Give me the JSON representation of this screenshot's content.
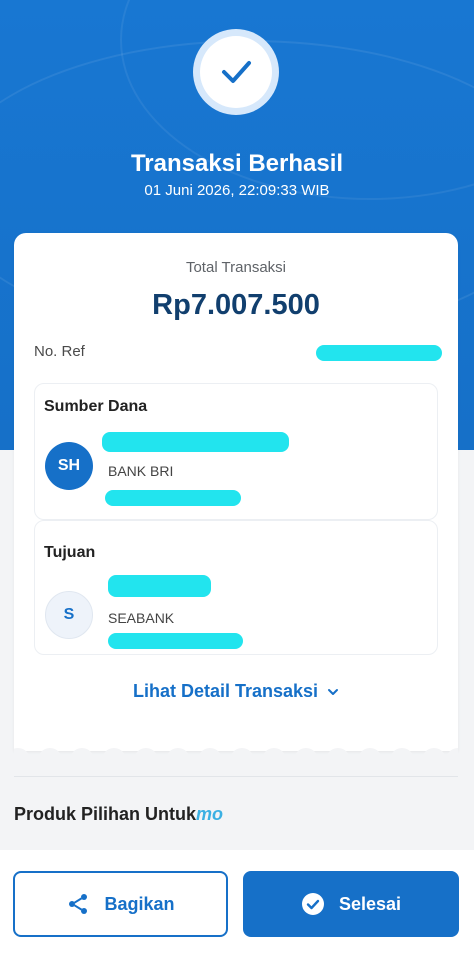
{
  "header": {
    "title": "Transaksi Berhasil",
    "datetime": "01 Juni 2026, 22:09:33 WIB",
    "status_icon": "check-icon"
  },
  "summary": {
    "total_label": "Total Transaksi",
    "total_amount": "Rp7.007.500",
    "ref_label": "No. Ref"
  },
  "source": {
    "section_title": "Sumber Dana",
    "avatar_initials": "SH",
    "bank": "BANK BRI"
  },
  "destination": {
    "section_title": "Tujuan",
    "avatar_initials": "S",
    "bank": "SEABANK"
  },
  "detail_link": {
    "label": "Lihat Detail Transaksi",
    "icon": "chevron-down-icon"
  },
  "promo": {
    "label": "Produk Pilihan Untuk",
    "brand": "mo"
  },
  "actions": {
    "share_label": "Bagikan",
    "share_icon": "share-icon",
    "done_label": "Selesai",
    "done_icon": "check-circle-icon"
  },
  "colors": {
    "primary": "#1670c8",
    "amount": "#113f6e",
    "redaction": "#22e4ee"
  }
}
